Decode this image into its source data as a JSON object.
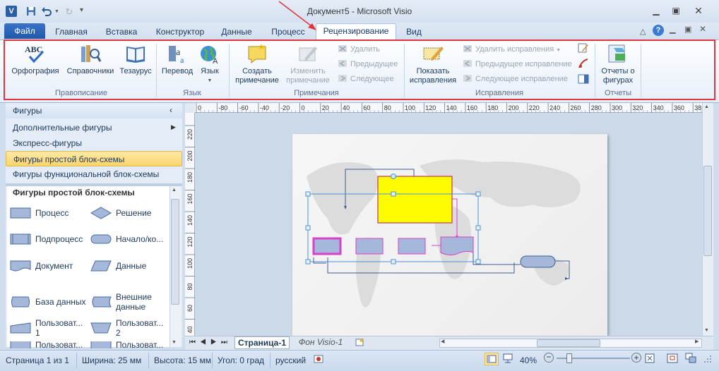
{
  "window": {
    "title": "Документ5 - Microsoft Visio"
  },
  "quick_access": {
    "save_icon": "save-icon",
    "undo_icon": "undo-icon",
    "redo_icon": "redo-icon",
    "customize_icon": "customize-icon"
  },
  "tabs": [
    {
      "label": "Файл",
      "name": "tab-file"
    },
    {
      "label": "Главная",
      "name": "tab-home"
    },
    {
      "label": "Вставка",
      "name": "tab-insert"
    },
    {
      "label": "Конструктор",
      "name": "tab-design"
    },
    {
      "label": "Данные",
      "name": "tab-data"
    },
    {
      "label": "Процесс",
      "name": "tab-process"
    },
    {
      "label": "Рецензирование",
      "name": "tab-review"
    },
    {
      "label": "Вид",
      "name": "tab-view"
    }
  ],
  "ribbon": {
    "proofing": {
      "spelling": "Орфография",
      "research": "Справочники",
      "thesaurus": "Тезаурус",
      "label": "Правописание"
    },
    "language": {
      "translate": "Перевод",
      "language": "Язык",
      "label": "Язык"
    },
    "comments": {
      "new_line1": "Создать",
      "new_line2": "примечание",
      "edit_line1": "Изменить",
      "edit_line2": "примечание",
      "delete": "Удалить",
      "previous": "Предыдущее",
      "next": "Следующее",
      "label": "Примечания"
    },
    "markup": {
      "show_line1": "Показать",
      "show_line2": "исправления",
      "delete": "Удалить исправления",
      "previous": "Предыдущее исправление",
      "next": "Следующее исправление",
      "label": "Исправления"
    },
    "reports": {
      "btn_line1": "Отчеты о",
      "btn_line2": "фигурах",
      "label": "Отчеты"
    }
  },
  "shapes_pane": {
    "title": "Фигуры",
    "more_shapes": "Дополнительные фигуры",
    "quick_shapes": "Экспресс-фигуры",
    "basic_flowchart": "Фигуры простой блок-схемы",
    "cross_functional": "Фигуры функциональной блок-схемы",
    "stencil_title": "Фигуры простой блок-схемы",
    "shapes_left": [
      "Процесс",
      "Подпроцесс",
      "Документ",
      "База данных",
      "Пользоват... 1",
      "Пользоват..."
    ],
    "shapes_right": [
      "Решение",
      "Начало/ко...",
      "Данные",
      "Внешние данные",
      "Пользоват... 2",
      "Пользоват..."
    ]
  },
  "ruler": {
    "h_ticks": [
      "0",
      "-80",
      "-60",
      "-40",
      "-20",
      "0",
      "20",
      "40",
      "60",
      "80",
      "100",
      "120",
      "140",
      "160",
      "180",
      "200",
      "220",
      "240",
      "260",
      "280",
      "300",
      "320",
      "340",
      "360",
      "38"
    ],
    "v_ticks": [
      "220",
      "200",
      "180",
      "160",
      "140",
      "120",
      "100",
      "80",
      "60",
      "40"
    ]
  },
  "page_tabs": {
    "page1": "Страница-1",
    "background": "Фон Visio-1"
  },
  "status": {
    "page": "Страница 1 из 1",
    "width": "Ширина: 25 мм",
    "height": "Высота: 15 мм",
    "angle": "Угол: 0 град",
    "language": "русский",
    "zoom": "40%"
  }
}
